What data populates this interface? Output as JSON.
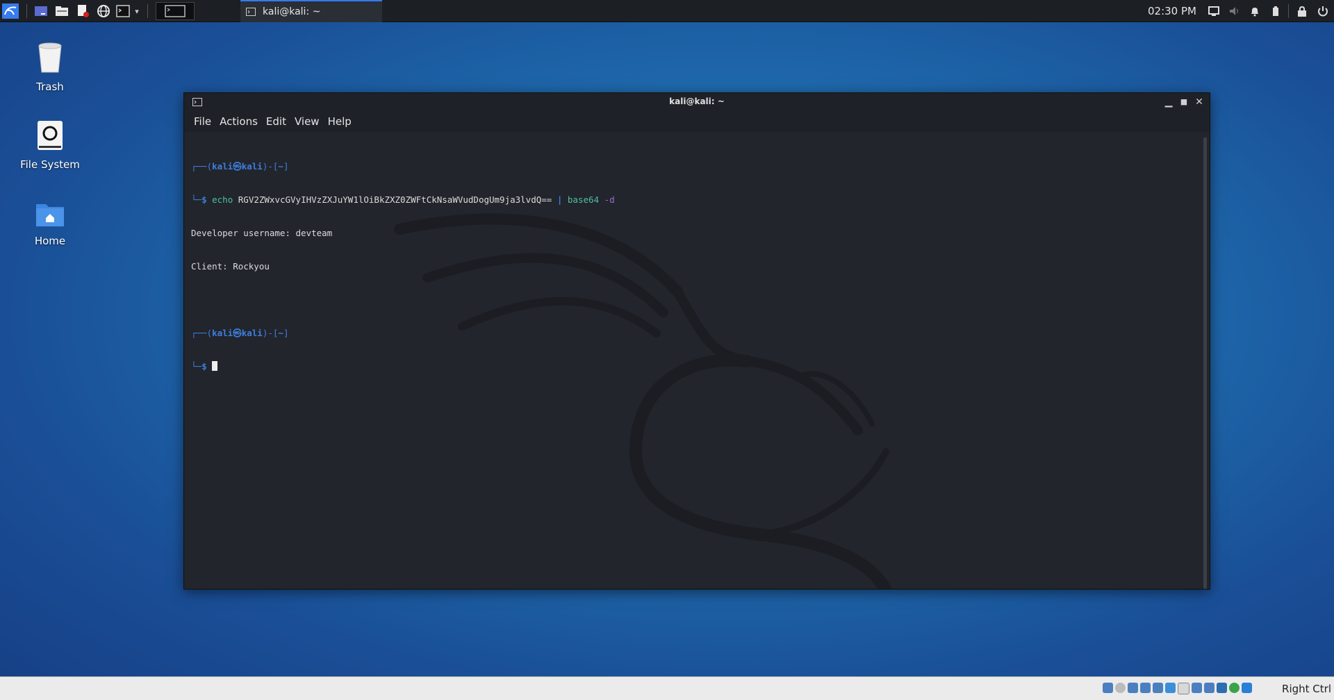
{
  "panel": {
    "task_title": "kali@kali: ~",
    "clock": "02:30 PM"
  },
  "desktop": {
    "icons": [
      {
        "label": "Trash"
      },
      {
        "label": "File System"
      },
      {
        "label": "Home"
      }
    ]
  },
  "window": {
    "title": "kali@kali: ~",
    "menu": [
      "File",
      "Actions",
      "Edit",
      "View",
      "Help"
    ]
  },
  "terminal": {
    "prompt_user": "kali",
    "prompt_host": "kali",
    "prompt_dir": "~",
    "prompt_dollar": "$",
    "command_echo": "echo",
    "command_arg": "RGV2ZWxvcGVyIHVzZXJuYW1lOiBkZXZ0ZWFtCkNsaWVudDogUm9ja3lvdQ==",
    "command_pipe": "|",
    "command_prog": "base64",
    "command_flag": "-d",
    "output": [
      "Developer username: devteam",
      "Client: Rockyou"
    ]
  },
  "statusbar": {
    "host_key": "Right Ctrl"
  }
}
